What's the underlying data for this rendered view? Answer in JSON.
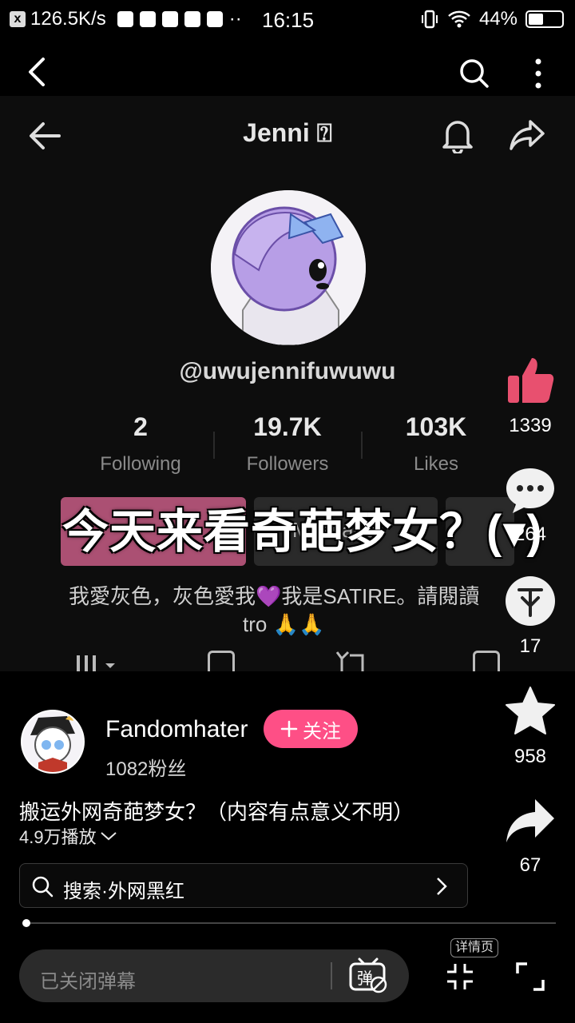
{
  "status_bar": {
    "speed": "126.5K/s",
    "time": "16:15",
    "battery": "44%"
  },
  "video": {
    "title": "Jenni ⍰",
    "handle": "@uwujennifuwuwu",
    "stats": [
      {
        "num": "2",
        "label": "Following"
      },
      {
        "num": "19.7K",
        "label": "Followers"
      },
      {
        "num": "103K",
        "label": "Likes"
      }
    ],
    "message_label": "Message",
    "overlay_caption": "今天来看奇葩梦女？(▾)",
    "bio_line1": "我愛灰色，灰色愛我💜我是SATIRE。請閱讀",
    "bio_line2": "tro 🙏🙏"
  },
  "actions": {
    "like_count": "1339",
    "comment_count": "264",
    "coin_count": "17",
    "favorite_count": "958",
    "share_count": "67"
  },
  "author": {
    "name": "Fandomhater",
    "follow_label": "关注",
    "fans": "1082粉丝"
  },
  "video_info": {
    "title": "搬运外网奇葩梦女？（内容有点意义不明）",
    "plays": "4.9万播放"
  },
  "search": {
    "text": "搜索·外网黑红"
  },
  "danmu": {
    "placeholder": "已关闭弹幕",
    "detail_label": "详情页"
  },
  "colors": {
    "accent": "#fe4f86",
    "like": "#e8506f"
  }
}
